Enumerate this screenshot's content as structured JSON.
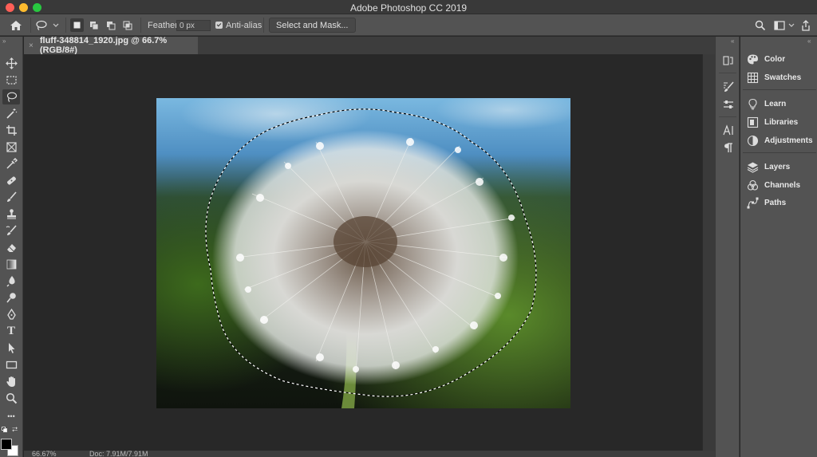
{
  "window": {
    "title": "Adobe Photoshop CC 2019"
  },
  "options_bar": {
    "feather_label": "Feather:",
    "feather_value": "0 px",
    "anti_alias_label": "Anti-alias",
    "anti_alias_checked": true,
    "select_mask_label": "Select and Mask..."
  },
  "document": {
    "tab_title": "fluff-348814_1920.jpg @ 66.7% (RGB/8#)",
    "close_glyph": "×"
  },
  "status": {
    "zoom": "66.67%",
    "doc_size": "Doc: 7.91M/7.91M"
  },
  "tools": [
    {
      "name": "move-tool",
      "icon": "move-icon"
    },
    {
      "name": "marquee-tool",
      "icon": "rect-marquee-icon"
    },
    {
      "name": "lasso-tool",
      "icon": "lasso-icon",
      "active": true
    },
    {
      "name": "magic-wand-tool",
      "icon": "magic-wand-icon"
    },
    {
      "name": "crop-tool",
      "icon": "crop-icon"
    },
    {
      "name": "frame-tool",
      "icon": "frame-icon"
    },
    {
      "name": "eyedropper-tool",
      "icon": "eyedropper-icon"
    },
    {
      "name": "healing-brush-tool",
      "icon": "bandage-icon"
    },
    {
      "name": "brush-tool",
      "icon": "brush-icon"
    },
    {
      "name": "clone-stamp-tool",
      "icon": "stamp-icon"
    },
    {
      "name": "history-brush-tool",
      "icon": "history-brush-icon"
    },
    {
      "name": "eraser-tool",
      "icon": "eraser-icon"
    },
    {
      "name": "gradient-tool",
      "icon": "gradient-icon"
    },
    {
      "name": "blur-tool",
      "icon": "drop-icon"
    },
    {
      "name": "dodge-tool",
      "icon": "dodge-icon"
    },
    {
      "name": "pen-tool",
      "icon": "pen-icon"
    },
    {
      "name": "type-tool",
      "icon": "type-icon"
    },
    {
      "name": "path-selection-tool",
      "icon": "arrow-icon"
    },
    {
      "name": "rectangle-tool",
      "icon": "rectangle-icon"
    },
    {
      "name": "hand-tool",
      "icon": "hand-icon"
    },
    {
      "name": "zoom-tool",
      "icon": "zoom-icon"
    },
    {
      "name": "edit-toolbar",
      "icon": "more-icon"
    }
  ],
  "type_tool_glyph": "T",
  "more_glyph": "•••",
  "panels": {
    "group1": [
      {
        "label": "Color",
        "icon": "color-palette-icon"
      },
      {
        "label": "Swatches",
        "icon": "swatches-grid-icon"
      }
    ],
    "group2": [
      {
        "label": "Learn",
        "icon": "lightbulb-icon"
      },
      {
        "label": "Libraries",
        "icon": "libraries-icon"
      },
      {
        "label": "Adjustments",
        "icon": "adjustments-icon"
      }
    ],
    "group3": [
      {
        "label": "Layers",
        "icon": "layers-icon"
      },
      {
        "label": "Channels",
        "icon": "channels-icon"
      },
      {
        "label": "Paths",
        "icon": "paths-icon"
      }
    ]
  },
  "colors": {
    "foreground": "#000000",
    "background": "#ffffff"
  }
}
